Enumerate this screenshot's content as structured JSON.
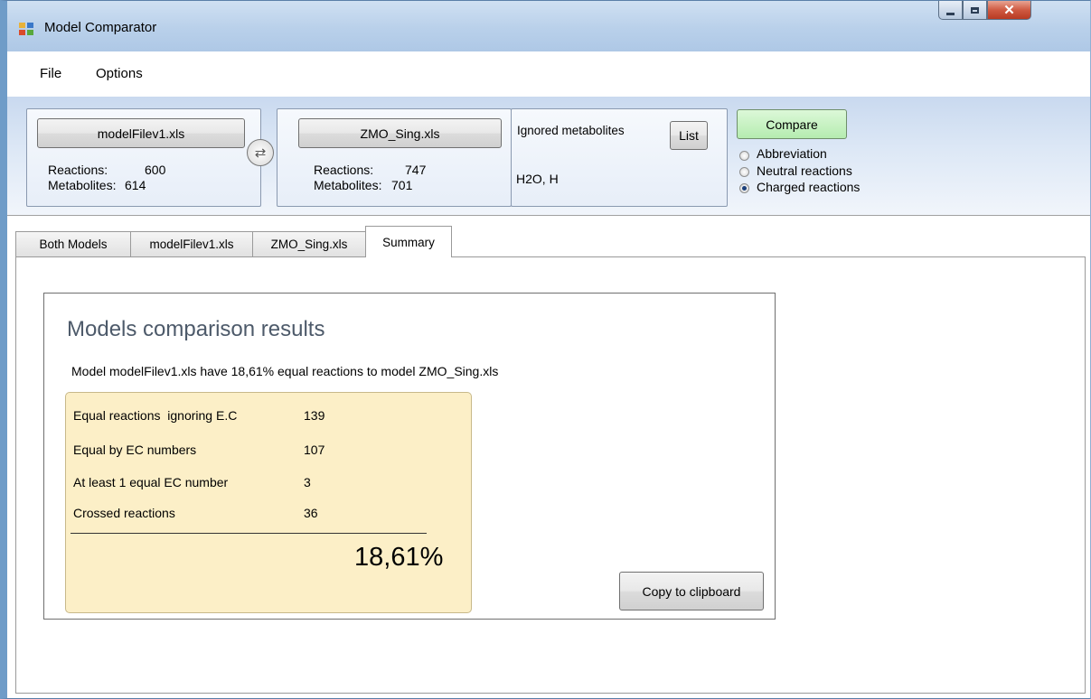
{
  "window": {
    "title": "Model Comparator"
  },
  "menu": {
    "file": "File",
    "options": "Options"
  },
  "model_a": {
    "button": "modelFilev1.xls",
    "reactions_label": "Reactions:",
    "reactions": "600",
    "metabolites_label": "Metabolites:",
    "metabolites": "614"
  },
  "model_b": {
    "button": "ZMO_Sing.xls",
    "reactions_label": "Reactions:",
    "reactions": "747",
    "metabolites_label": "Metabolites:",
    "metabolites": "701"
  },
  "ignored": {
    "label": "Ignored metabolites",
    "list_button": "List",
    "value": "H2O, H"
  },
  "compare": {
    "button": "Compare",
    "options": [
      "Abbreviation",
      "Neutral reactions",
      "Charged reactions"
    ],
    "selected": "Charged reactions"
  },
  "tabs": [
    "Both Models",
    "modelFilev1.xls",
    "ZMO_Sing.xls",
    "Summary"
  ],
  "active_tab": "Summary",
  "summary": {
    "heading": "Models comparison results",
    "sentence": "Model modelFilev1.xls have 18,61% equal reactions to model ZMO_Sing.xls",
    "rows": [
      {
        "label": "Equal reactions  ignoring E.C",
        "value": "139"
      },
      {
        "label": "Equal by EC numbers",
        "value": "107"
      },
      {
        "label": "At least 1 equal EC number",
        "value": "3"
      },
      {
        "label": "Crossed reactions",
        "value": "36"
      }
    ],
    "total": "18,61%",
    "copy_button": "Copy to clipboard"
  },
  "colors": {
    "compare_button": "#c6f2c2",
    "summary_box": "#fcefc7",
    "heading": "#4d5a6a",
    "close_button": "#c94b32"
  },
  "icons": {
    "swap": "swap-arrows-icon",
    "app": "app-window-icon"
  }
}
